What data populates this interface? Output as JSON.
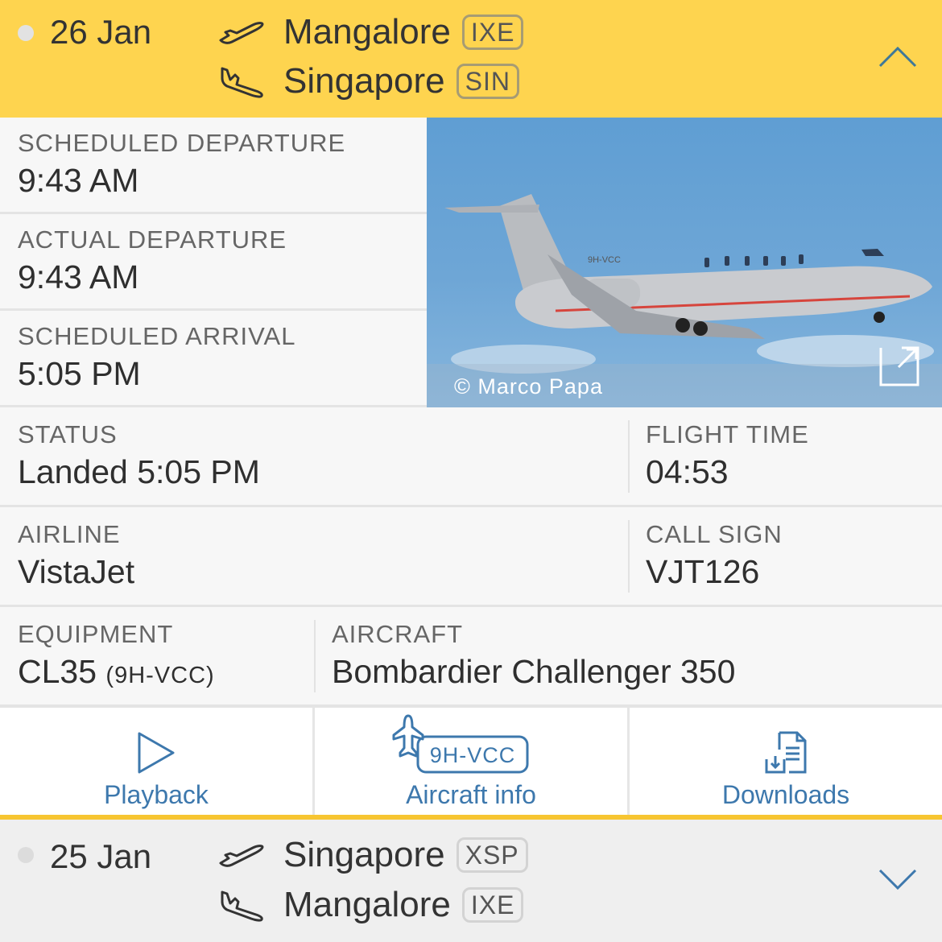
{
  "flights": [
    {
      "date": "26 Jan",
      "origin": {
        "city": "Mangalore",
        "code": "IXE"
      },
      "destination": {
        "city": "Singapore",
        "code": "SIN"
      },
      "expanded": true,
      "header_color": "#fed44f"
    },
    {
      "date": "25 Jan",
      "origin": {
        "city": "Singapore",
        "code": "XSP"
      },
      "destination": {
        "city": "Mangalore",
        "code": "IXE"
      },
      "expanded": false,
      "header_color": "#efefef"
    }
  ],
  "details": {
    "scheduled_departure": {
      "label": "SCHEDULED DEPARTURE",
      "value": "9:43 AM"
    },
    "actual_departure": {
      "label": "ACTUAL DEPARTURE",
      "value": "9:43 AM"
    },
    "scheduled_arrival": {
      "label": "SCHEDULED ARRIVAL",
      "value": "5:05 PM"
    },
    "status": {
      "label": "STATUS",
      "value": "Landed 5:05 PM"
    },
    "flight_time": {
      "label": "FLIGHT TIME",
      "value": "04:53"
    },
    "airline": {
      "label": "AIRLINE",
      "value": "VistaJet"
    },
    "call_sign": {
      "label": "CALL SIGN",
      "value": "VJT126"
    },
    "equipment": {
      "label": "EQUIPMENT",
      "value": "CL35",
      "registration": "(9H-VCC)"
    },
    "aircraft": {
      "label": "AIRCRAFT",
      "value": "Bombardier Challenger 350"
    }
  },
  "photo": {
    "credit": "© Marco Papa",
    "tail_marking": "9H-VCC"
  },
  "actions": {
    "playback": "Playback",
    "aircraft_info": "Aircraft info",
    "aircraft_badge": "9H-VCC",
    "downloads": "Downloads"
  },
  "colors": {
    "accent_blue": "#3d78ad",
    "header_yellow": "#fed44f",
    "separator_yellow": "#f7c531"
  },
  "icons": {
    "departure": "plane-takeoff-icon",
    "arrival": "plane-landing-icon",
    "collapse": "chevron-up-icon",
    "expand": "chevron-down-icon",
    "open_external": "external-link-icon",
    "playback": "play-icon",
    "aircraft": "airplane-icon",
    "downloads": "document-download-icon"
  }
}
